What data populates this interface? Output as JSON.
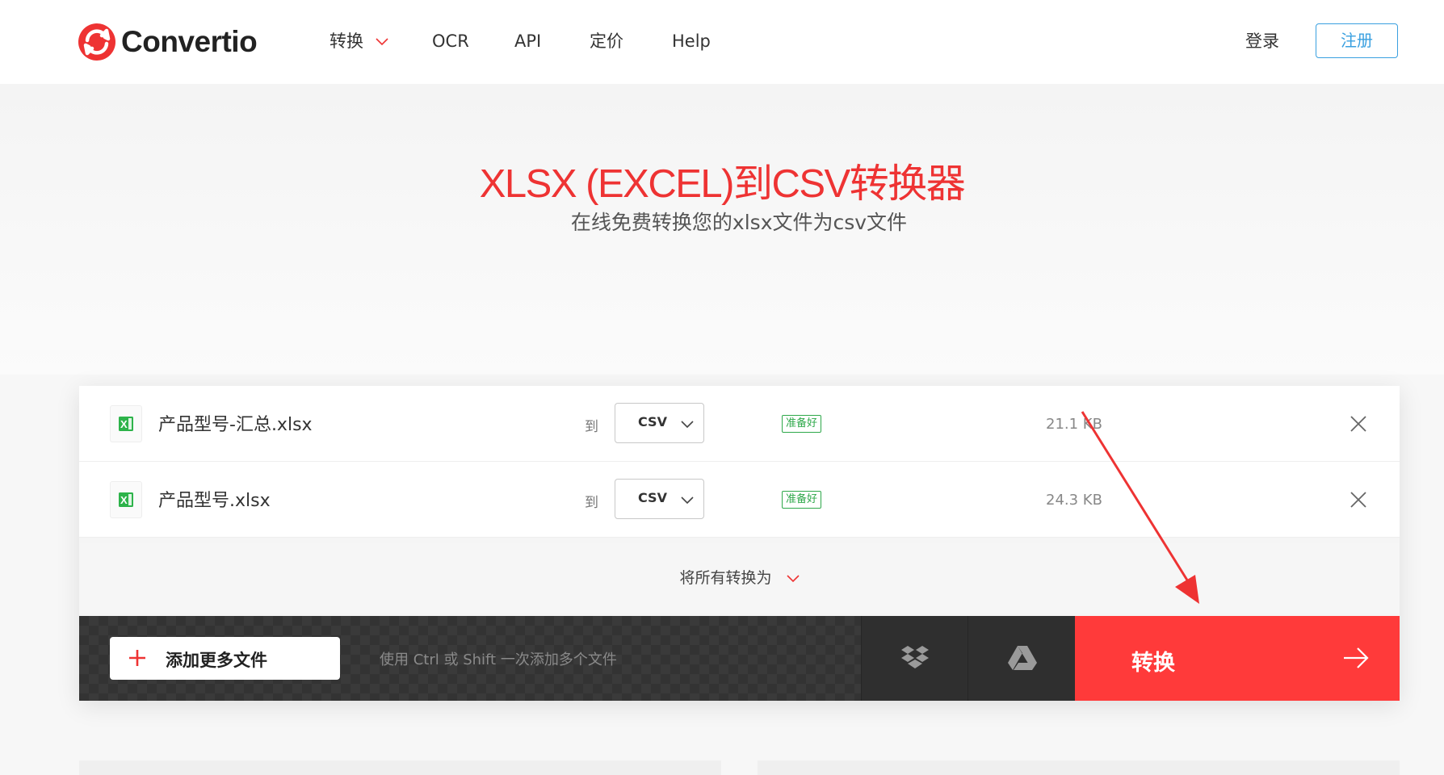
{
  "brand": {
    "name": "Convertio",
    "accent": "#ee3333"
  },
  "nav": {
    "items": [
      {
        "label": "转换",
        "has_dropdown": true
      },
      {
        "label": "OCR"
      },
      {
        "label": "API"
      },
      {
        "label": "定价"
      },
      {
        "label": "Help"
      }
    ],
    "login": "登录",
    "signup": "注册"
  },
  "hero": {
    "title": "XLSX (EXCEL)到CSV转换器",
    "subtitle": "在线免费转换您的xlsx文件为csv文件"
  },
  "files": [
    {
      "name": "产品型号-汇总.xlsx",
      "to_label": "到",
      "format": "CSV",
      "status": "准备好",
      "size": "21.1 KB",
      "icon": "excel-file-icon"
    },
    {
      "name": "产品型号.xlsx",
      "to_label": "到",
      "format": "CSV",
      "status": "准备好",
      "size": "24.3 KB",
      "icon": "excel-file-icon"
    }
  ],
  "convert_all": {
    "label": "将所有转换为"
  },
  "bottom_bar": {
    "add_files": "添加更多文件",
    "hint": "使用 Ctrl 或 Shift 一次添加多个文件",
    "dropbox_icon": "dropbox-icon",
    "gdrive_icon": "google-drive-icon",
    "convert": "转换"
  }
}
